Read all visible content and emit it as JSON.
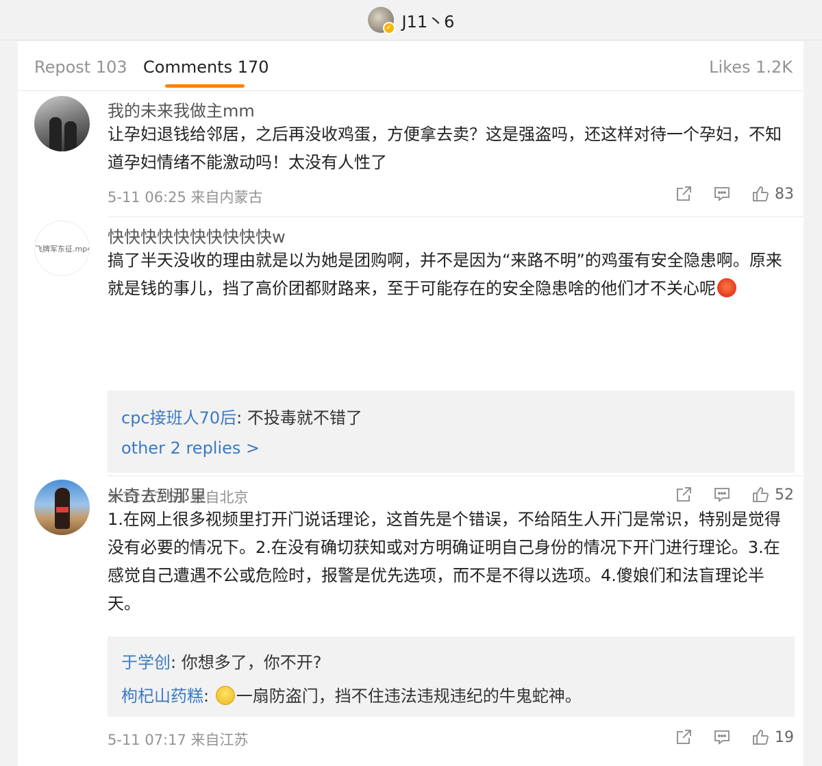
{
  "header": {
    "username": "J11丶6"
  },
  "tabs": {
    "repost": "Repost 103",
    "comments": "Comments 170",
    "likes": "Likes 1.2K"
  },
  "comments": [
    {
      "user": "我的未来我做主mm",
      "text": "让孕妇退钱给邻居，之后再没收鸡蛋，方便拿去卖？这是强盗吗，还这样对待一个孕妇，不知道孕妇情绪不能激动吗！太没有人性了",
      "meta": "5-11 06:25 来自内蒙古",
      "likes": "83"
    },
    {
      "user": "快快快快快快快快快快w",
      "avatar_text": "飞牌军东征.mp4",
      "text": "搞了半天没收的理由就是以为她是团购啊，并不是因为“来路不明”的鸡蛋有安全隐患啊。原来就是钱的事儿，挡了高价团都财路来，至于可能存在的安全隐患啥的他们才不关心呢",
      "replies": [
        {
          "user": "cpc接班人70后",
          "text": ": 不投毒就不错了"
        }
      ],
      "more_replies": "other 2 replies >",
      "meta": "5-11 07:51 来自北京",
      "likes": "52"
    },
    {
      "user": "米奇去到那里",
      "text": "1.在网上很多视频里打开门说话理论，这首先是个错误，不给陌生人开门是常识，特别是觉得没有必要的情况下。2.在没有确切获知或对方明确证明自己身份的情况下开门进行理论。3.在感觉自己遭遇不公或危险时，报警是优先选项，而不是不得以选项。4.傻娘们和法盲理论半天。",
      "replies": [
        {
          "user": "于学创",
          "text": ": 你想多了，你不开?"
        },
        {
          "user": "枸杞山药糕",
          "text": "一扇防盗门，挡不住违法违规违纪的牛鬼蛇神。"
        }
      ],
      "meta": "5-11 07:17 来自江苏",
      "likes": "19"
    }
  ]
}
